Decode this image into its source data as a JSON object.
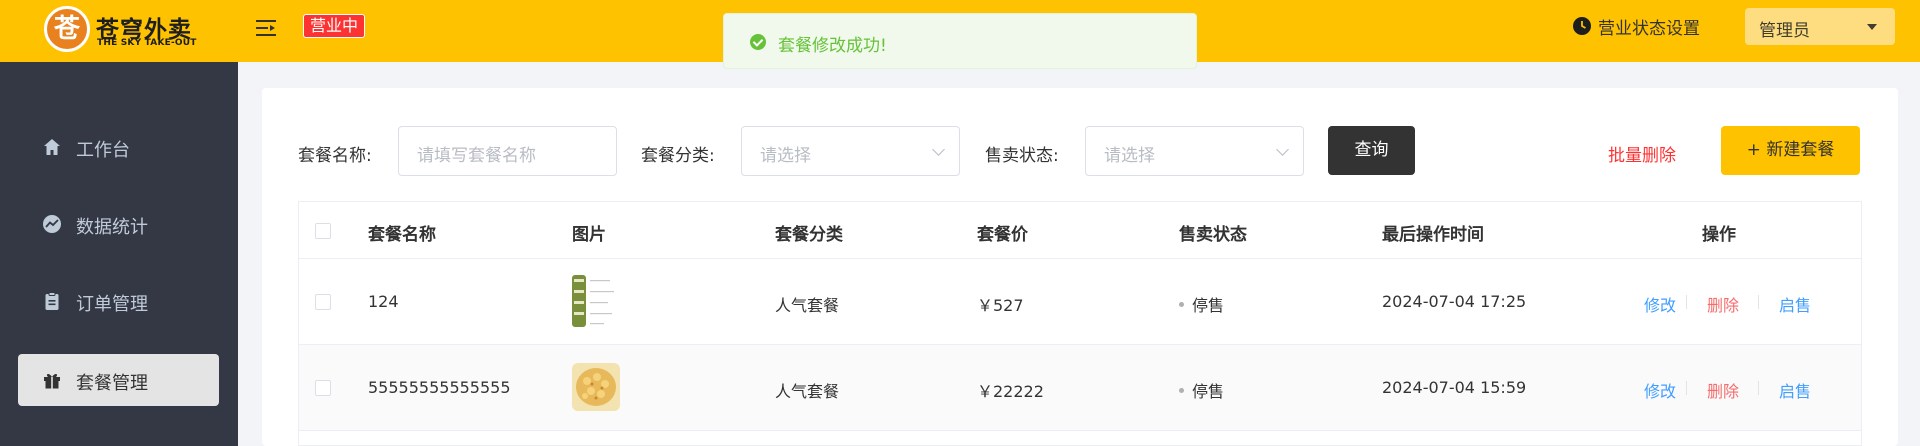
{
  "header": {
    "logo_mark": "苍",
    "logo_cn": "苍穹外卖",
    "logo_en": "THE SKY TAKE-OUT",
    "status_tag": "营业中",
    "biz_setting_label": "营业状态设置",
    "user_label": "管理员",
    "accent_color": "#ffc200"
  },
  "toast": {
    "message": "套餐修改成功!"
  },
  "sidebar": {
    "items": [
      {
        "label": "工作台",
        "icon": "home-icon",
        "active": false
      },
      {
        "label": "数据统计",
        "icon": "chart-icon",
        "active": false
      },
      {
        "label": "订单管理",
        "icon": "clipboard-icon",
        "active": false
      },
      {
        "label": "套餐管理",
        "icon": "gift-icon",
        "active": true
      }
    ]
  },
  "filters": {
    "name_label": "套餐名称:",
    "name_placeholder": "请填写套餐名称",
    "category_label": "套餐分类:",
    "category_placeholder": "请选择",
    "status_label": "售卖状态:",
    "status_placeholder": "请选择",
    "query_button": "查询",
    "batch_delete": "批量删除",
    "new_button": "+ 新建套餐"
  },
  "table": {
    "columns": [
      "套餐名称",
      "图片",
      "套餐分类",
      "套餐价",
      "售卖状态",
      "最后操作时间",
      "操作"
    ],
    "rows": [
      {
        "name": "124",
        "category": "人气套餐",
        "price": "￥527",
        "status": "停售",
        "time": "2024-07-04 17:25",
        "ops": [
          "修改",
          "删除",
          "启售"
        ]
      },
      {
        "name": "55555555555555",
        "category": "人气套餐",
        "price": "￥22222",
        "status": "停售",
        "time": "2024-07-04 15:59",
        "ops": [
          "修改",
          "删除",
          "启售"
        ]
      }
    ]
  }
}
